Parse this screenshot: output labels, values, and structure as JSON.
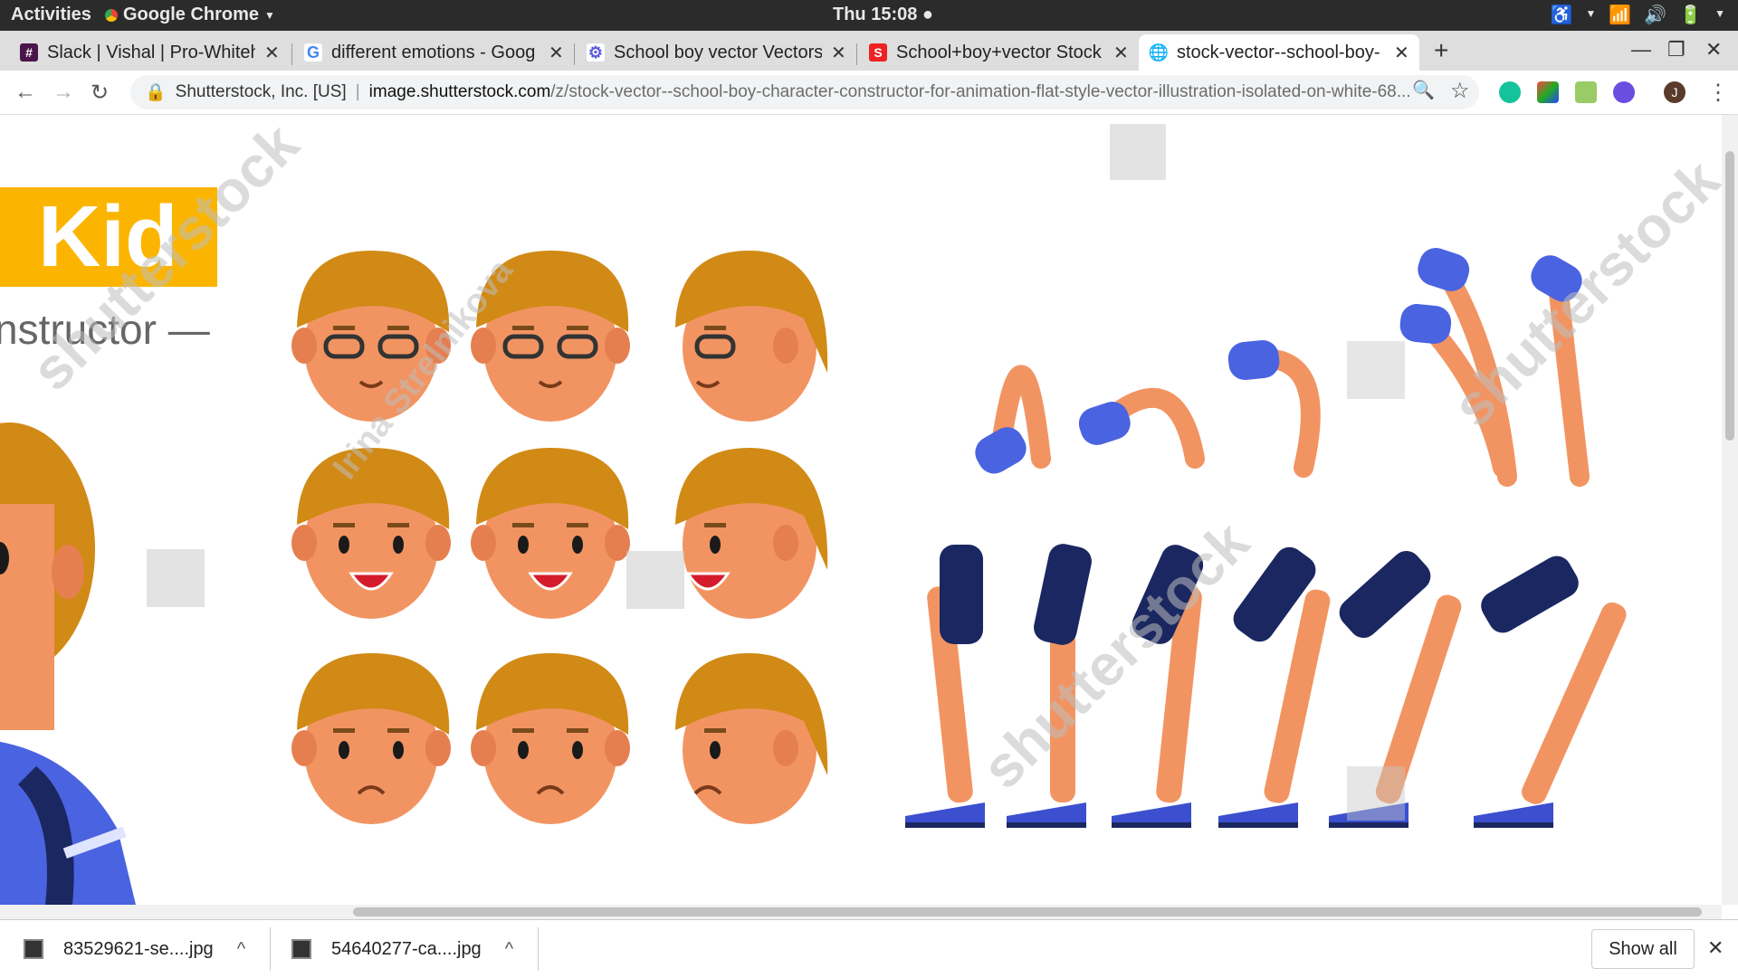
{
  "topbar": {
    "activities": "Activities",
    "app_name": "Google Chrome",
    "clock": "Thu 15:08"
  },
  "tabs": [
    {
      "title": "Slack | Vishal | Pro-Whiteh",
      "favicon": "slack-icon",
      "color": "#4a154b"
    },
    {
      "title": "different emotions - Goog",
      "favicon": "google-icon",
      "color": "#4285f4"
    },
    {
      "title": "School boy vector Vectors",
      "favicon": "vector-site-icon",
      "color": "#5b5bd6"
    },
    {
      "title": "School+boy+vector Stock",
      "favicon": "stock-site-icon",
      "color": "#e22"
    },
    {
      "title": "stock-vector--school-boy-",
      "favicon": "globe-icon",
      "color": "#555"
    }
  ],
  "omnibox": {
    "org": "Shutterstock, Inc. [US]",
    "domain": "image.shutterstock.com",
    "path": "/z/stock-vector--school-boy-character-constructor-for-animation-flat-style-vector-illustration-isolated-on-white-68..."
  },
  "profile_initial": "J",
  "content": {
    "banner_title": "Kid",
    "banner_subtitle": "nstructor —",
    "watermark_author": "Irina Strelnikova",
    "watermark_brand": "shutterstock",
    "colors": {
      "hair": "#d18a16",
      "skin": "#f29462",
      "sleeve": "#4a63e0",
      "shorts": "#1b2760",
      "banner": "#fbb500"
    }
  },
  "downloads": [
    {
      "name": "83529621-se....jpg"
    },
    {
      "name": "54640277-ca....jpg"
    }
  ],
  "shelf": {
    "show_all": "Show all"
  }
}
